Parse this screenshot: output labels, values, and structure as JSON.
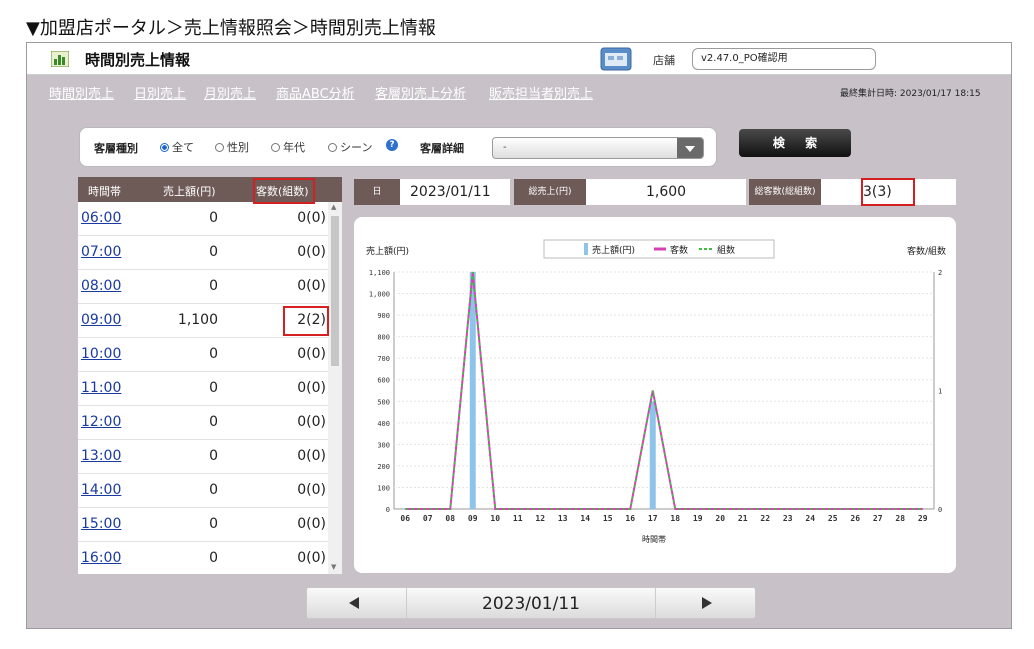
{
  "caption": "▼加盟店ポータル＞売上情報照会＞時間別売上情報",
  "app": {
    "title": "時間別売上情報",
    "store_label": "店舗",
    "store_value": "v2.47.0_PO確認用"
  },
  "nav": {
    "links": [
      "時間別売上",
      "日別売上",
      "月別売上",
      "商品ABC分析",
      "客層別売上分析",
      "販売担当者別売上"
    ],
    "last_update": "最終集計日時: 2023/01/17 18:15"
  },
  "search": {
    "segment_label": "客層種別",
    "options": [
      "全て",
      "性別",
      "年代",
      "シーン"
    ],
    "selected": "全て",
    "detail_label": "客層詳細",
    "detail_value": "-",
    "search_button": "検 索"
  },
  "table": {
    "headers": [
      "時間帯",
      "売上額(円)",
      "客数(組数)"
    ],
    "rows": [
      {
        "time": "06:00",
        "amount": "0",
        "count": "0(0)"
      },
      {
        "time": "07:00",
        "amount": "0",
        "count": "0(0)"
      },
      {
        "time": "08:00",
        "amount": "0",
        "count": "0(0)"
      },
      {
        "time": "09:00",
        "amount": "1,100",
        "count": "2(2)"
      },
      {
        "time": "10:00",
        "amount": "0",
        "count": "0(0)"
      },
      {
        "time": "11:00",
        "amount": "0",
        "count": "0(0)"
      },
      {
        "time": "12:00",
        "amount": "0",
        "count": "0(0)"
      },
      {
        "time": "13:00",
        "amount": "0",
        "count": "0(0)"
      },
      {
        "time": "14:00",
        "amount": "0",
        "count": "0(0)"
      },
      {
        "time": "15:00",
        "amount": "0",
        "count": "0(0)"
      },
      {
        "time": "16:00",
        "amount": "0",
        "count": "0(0)"
      }
    ]
  },
  "summary": {
    "day_label": "日",
    "date": "2023/01/11",
    "total_sales_label": "総売上(円)",
    "total_sales": "1,600",
    "total_customers_label": "総客数(総組数)",
    "total_customers": "3(3)"
  },
  "pager": {
    "date": "2023/01/11"
  },
  "colors": {
    "header_bg": "#6e5b58",
    "bar": "#8ec3ea",
    "customers_line": "#d63fb8",
    "groups_line": "#3fbf3f",
    "highlight": "#d42020"
  },
  "chart_data": {
    "type": "bar",
    "ylabel": "売上額(円)",
    "y2label": "客数/組数",
    "xlabel": "時間帯",
    "categories": [
      "06",
      "07",
      "08",
      "09",
      "10",
      "11",
      "12",
      "13",
      "14",
      "15",
      "16",
      "17",
      "18",
      "19",
      "20",
      "21",
      "22",
      "23",
      "24",
      "25",
      "26",
      "27",
      "28",
      "29"
    ],
    "ylim": [
      0,
      1100
    ],
    "y2lim": [
      0,
      2
    ],
    "yticks": [
      "0",
      "100",
      "200",
      "300",
      "400",
      "500",
      "600",
      "700",
      "800",
      "900",
      "1,000",
      "1,100"
    ],
    "y2ticks": [
      "0",
      "1",
      "2"
    ],
    "legend_position": "top",
    "series": [
      {
        "name": "売上額(円)",
        "type": "bar",
        "values": [
          0,
          0,
          0,
          1100,
          0,
          0,
          0,
          0,
          0,
          0,
          0,
          500,
          0,
          0,
          0,
          0,
          0,
          0,
          0,
          0,
          0,
          0,
          0,
          0
        ]
      },
      {
        "name": "客数",
        "type": "line",
        "axis": "right",
        "values": [
          0,
          0,
          0,
          2,
          0,
          0,
          0,
          0,
          0,
          0,
          0,
          1,
          0,
          0,
          0,
          0,
          0,
          0,
          0,
          0,
          0,
          0,
          0,
          0
        ]
      },
      {
        "name": "組数",
        "type": "line",
        "axis": "right",
        "values": [
          0,
          0,
          0,
          2,
          0,
          0,
          0,
          0,
          0,
          0,
          0,
          1,
          0,
          0,
          0,
          0,
          0,
          0,
          0,
          0,
          0,
          0,
          0,
          0
        ]
      }
    ]
  }
}
